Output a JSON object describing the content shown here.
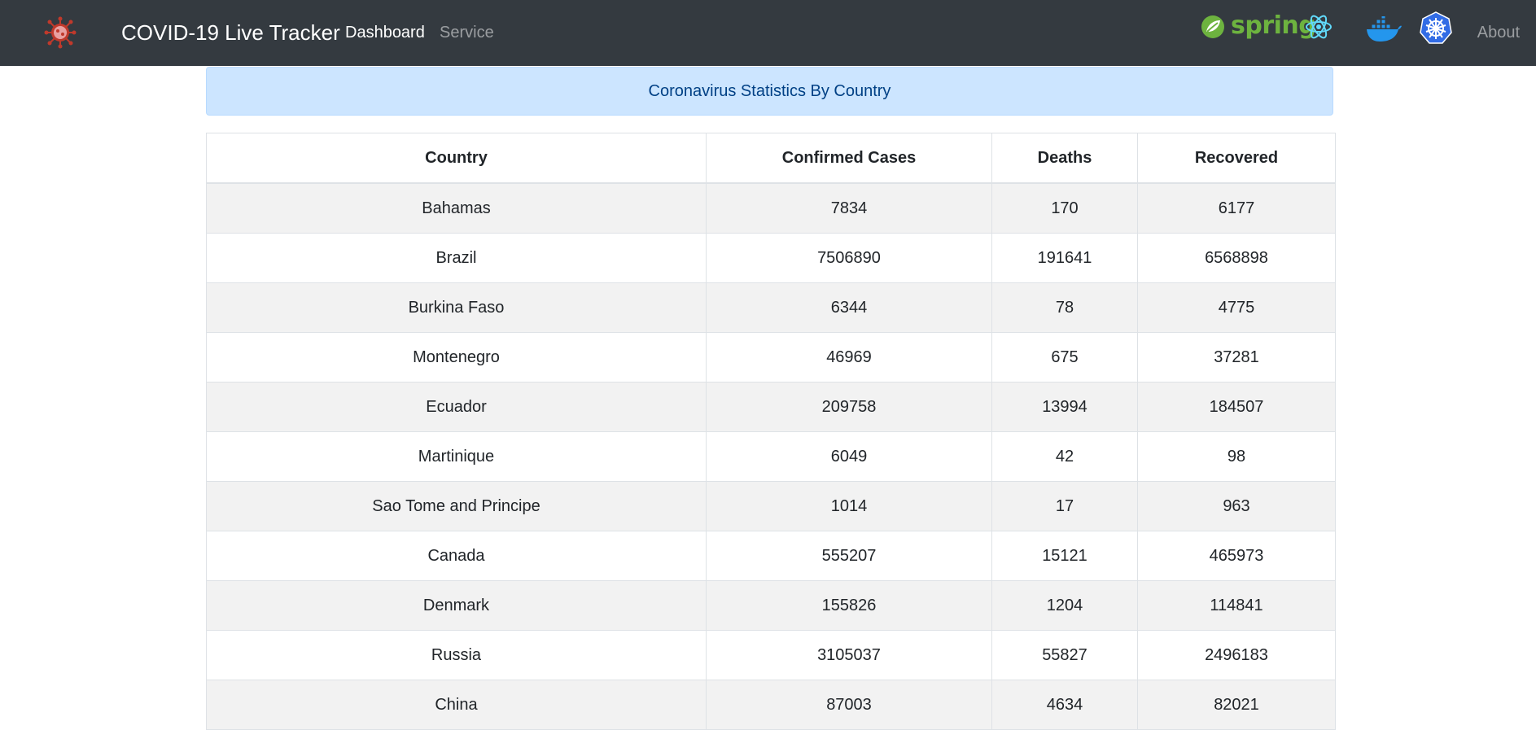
{
  "navbar": {
    "title": "COVID-19 Live Tracker",
    "links": {
      "dashboard": "Dashboard",
      "service": "Service",
      "about": "About"
    },
    "tech_icons": {
      "spring_text": "spring",
      "icons": [
        "virus-icon",
        "spring-logo",
        "react-logo",
        "docker-logo",
        "kubernetes-logo"
      ]
    }
  },
  "alert": {
    "text": "Coronavirus Statistics By Country"
  },
  "table": {
    "headers": [
      "Country",
      "Confirmed Cases",
      "Deaths",
      "Recovered"
    ],
    "rows": [
      [
        "Bahamas",
        "7834",
        "170",
        "6177"
      ],
      [
        "Brazil",
        "7506890",
        "191641",
        "6568898"
      ],
      [
        "Burkina Faso",
        "6344",
        "78",
        "4775"
      ],
      [
        "Montenegro",
        "46969",
        "675",
        "37281"
      ],
      [
        "Ecuador",
        "209758",
        "13994",
        "184507"
      ],
      [
        "Martinique",
        "6049",
        "42",
        "98"
      ],
      [
        "Sao Tome and Principe",
        "1014",
        "17",
        "963"
      ],
      [
        "Canada",
        "555207",
        "15121",
        "465973"
      ],
      [
        "Denmark",
        "155826",
        "1204",
        "114841"
      ],
      [
        "Russia",
        "3105037",
        "55827",
        "2496183"
      ],
      [
        "China",
        "87003",
        "4634",
        "82021"
      ]
    ]
  },
  "colors": {
    "navbar_bg": "#343a40",
    "alert_bg": "#cce5ff",
    "alert_text": "#004085",
    "spring_green": "#6db33f",
    "react_cyan": "#61dafb",
    "docker_blue": "#2496ed",
    "k8s_blue": "#326ce5"
  }
}
